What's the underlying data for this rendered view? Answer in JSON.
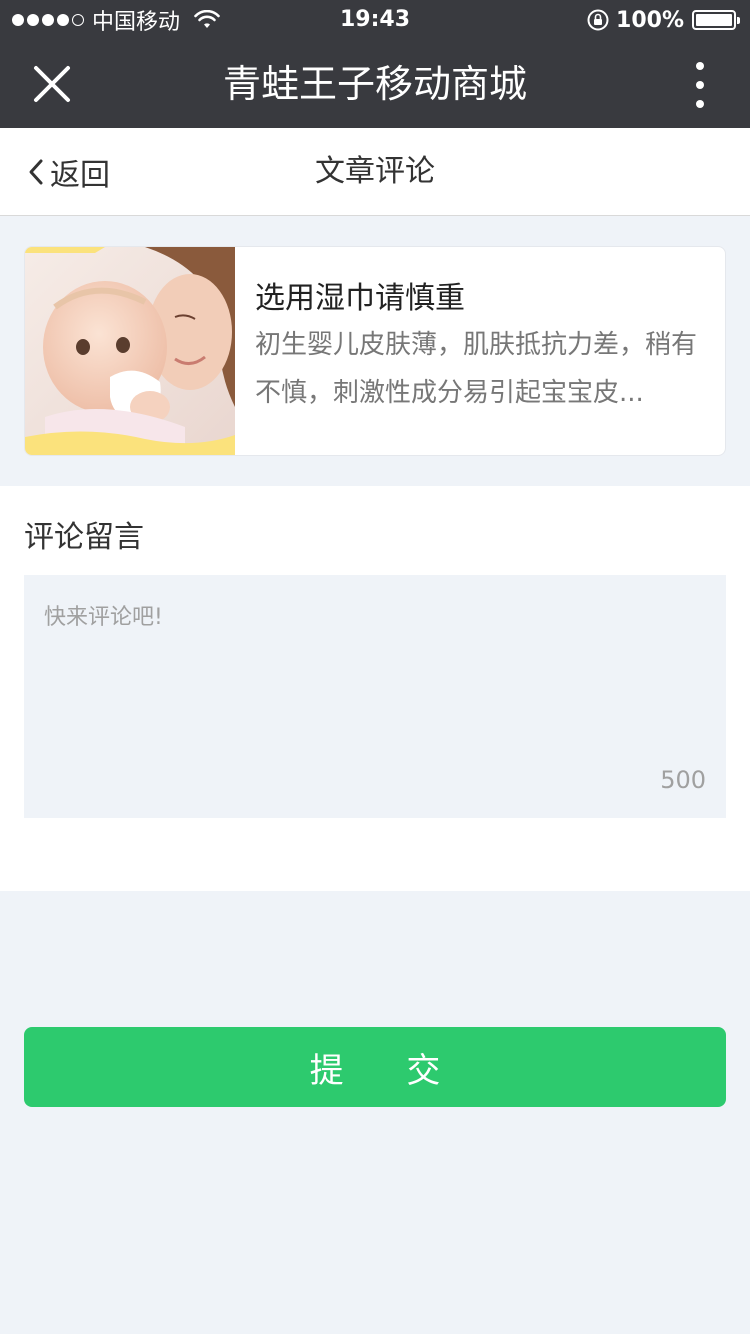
{
  "status_bar": {
    "carrier": "中国移动",
    "time": "19:43",
    "battery": "100%"
  },
  "title_bar": {
    "title": "青蛙王子移动商城"
  },
  "nav": {
    "back_label": "返回",
    "page_title": "文章评论"
  },
  "article": {
    "title": "选用湿巾请慎重",
    "summary": "初生婴儿皮肤薄，肌肤抵抗力差，稍有不慎，刺激性成分易引起宝宝皮..."
  },
  "comment": {
    "label": "评论留言",
    "placeholder": "快来评论吧!",
    "char_count": "500"
  },
  "submit": {
    "label": "提 交"
  },
  "colors": {
    "header_bg": "#393a3f",
    "page_bg": "#eff3f8",
    "accent_green": "#2dca6e"
  }
}
